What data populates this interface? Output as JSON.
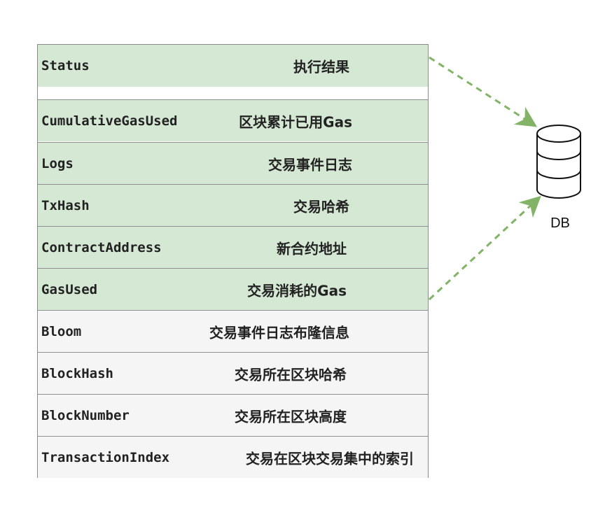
{
  "rows": [
    {
      "field": "Status",
      "desc": "执行结果",
      "color": "#d5e8d4"
    },
    {
      "field": "CumulativeGasUsed",
      "desc": "区块累计已用Gas",
      "color": "#d5e8d4"
    },
    {
      "field": "Logs",
      "desc": "交易事件日志",
      "color": "#d5e8d4"
    },
    {
      "field": "TxHash",
      "desc": "交易哈希",
      "color": "#d5e8d4"
    },
    {
      "field": "ContractAddress",
      "desc": "新合约地址",
      "color": "#d5e8d4"
    },
    {
      "field": "GasUsed",
      "desc": "交易消耗的Gas",
      "color": "#d5e8d4"
    },
    {
      "field": "Bloom",
      "desc": "交易事件日志布隆信息",
      "color": "#f5f5f5"
    },
    {
      "field": "BlockHash",
      "desc": "交易所在区块哈希",
      "color": "#f5f5f5"
    },
    {
      "field": "BlockNumber",
      "desc": "交易所在区块高度",
      "color": "#f5f5f5"
    },
    {
      "field": "TransactionIndex",
      "desc": "交易在区块交易集中的索引",
      "color": "#f5f5f5"
    }
  ],
  "db": {
    "label": "DB",
    "icon": "database-icon"
  },
  "colors": {
    "stored": "#d5e8d4",
    "not_stored": "#f5f5f5",
    "arrow": "#82b366"
  }
}
